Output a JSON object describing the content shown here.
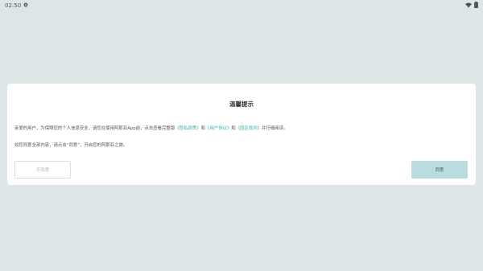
{
  "status_bar": {
    "time": "02:50",
    "left_icon": "notification-settings-icon",
    "right_icons": [
      "wifi-icon",
      "battery-icon"
    ]
  },
  "dialog": {
    "title": "温馨提示",
    "line1": {
      "prefix": "亲爱的用户，为保障您的个人信息安全，请您在使用阿那亚App前，点击查看完整版",
      "privacy_policy": "《隐私政策》",
      "and1": "和",
      "user_agreement": "《用户协议》",
      "and2": "和",
      "community_rules": "《园区规则》",
      "suffix": "并仔细阅读。"
    },
    "line2": "如您同意全部内容，请点击“同意”，开启您的阿那亚之旅。",
    "decline_label": "不同意",
    "agree_label": "同意"
  },
  "colors": {
    "background": "#dde6e7",
    "link": "#3fb1b1",
    "agree_button": "#b9dcde"
  }
}
